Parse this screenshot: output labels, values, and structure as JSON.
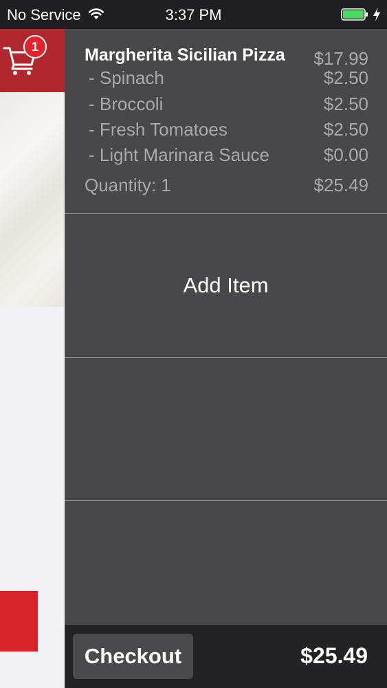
{
  "status_bar": {
    "carrier": "No Service",
    "time": "3:37 PM",
    "wifi_icon": "wifi-icon",
    "battery_icon": "battery-charging-icon",
    "battery_color": "#4cd964"
  },
  "cart": {
    "icon": "shopping-cart-icon",
    "badge_count": "1",
    "header_color": "#b0282e",
    "badge_color": "#e3232c"
  },
  "order_item": {
    "name": "Margherita Sicilian Pizza",
    "base_price": "$17.99",
    "modifiers": [
      {
        "name": "- Spinach",
        "price": "$2.50"
      },
      {
        "name": "- Broccoli",
        "price": "$2.50"
      },
      {
        "name": "- Fresh Tomatoes",
        "price": "$2.50"
      },
      {
        "name": "- Light Marinara Sauce",
        "price": "$0.00"
      }
    ],
    "quantity_label": "Quantity: 1",
    "line_total": "$25.49"
  },
  "add_item_label": "Add Item",
  "footer": {
    "checkout_label": "Checkout",
    "total": "$25.49"
  }
}
